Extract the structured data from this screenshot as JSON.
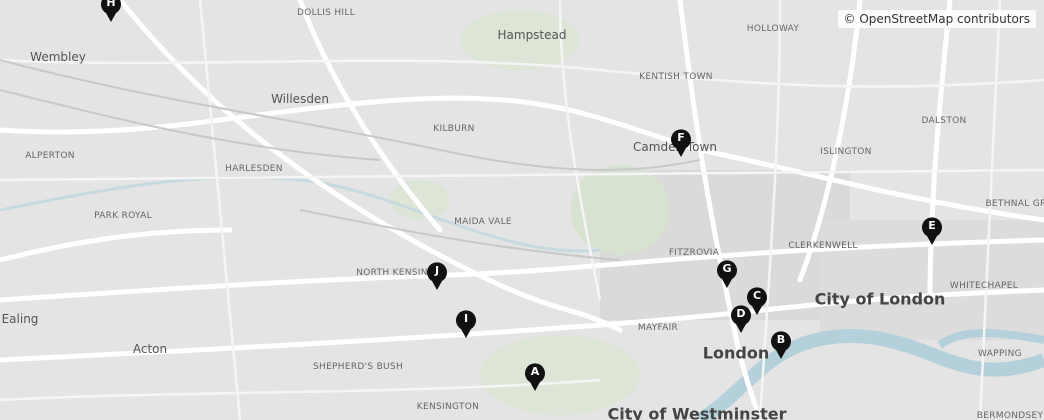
{
  "attribution": "© OpenStreetMap contributors",
  "places": {
    "dollis_hill": "DOLLIS HILL",
    "hampstead": "Hampstead",
    "holloway": "HOLLOWAY",
    "wembley": "Wembley",
    "kentish_town": "KENTISH TOWN",
    "willesden": "Willesden",
    "kilburn": "KILBURN",
    "dalston": "DALSTON",
    "alperton": "ALPERTON",
    "camden_town": "Camden Town",
    "islington": "ISLINGTON",
    "harlesden": "HARLESDEN",
    "bethnal_green": "BETHNAL GR",
    "park_royal": "PARK ROYAL",
    "maida_vale": "MAIDA VALE",
    "fitzrovia": "FITZROVIA",
    "clerkenwell": "CLERKENWELL",
    "north_kensington": "NORTH KENSIN",
    "city_of_london": "City of London",
    "whitechapel": "WHITECHAPEL",
    "ealing": "Ealing",
    "mayfair": "MAYFAIR",
    "acton": "Acton",
    "london": "London",
    "wapping": "WAPPING",
    "shepherds_bush": "SHEPHERD'S BUSH",
    "kensington": "KENSINGTON",
    "city_of_westminster": "City of Westminster",
    "bermondsey": "BERMONDSEY"
  },
  "markers": [
    {
      "label": "A"
    },
    {
      "label": "B"
    },
    {
      "label": "C"
    },
    {
      "label": "D"
    },
    {
      "label": "E"
    },
    {
      "label": "F"
    },
    {
      "label": "G"
    },
    {
      "label": "H"
    },
    {
      "label": "I"
    },
    {
      "label": "J"
    }
  ],
  "colors": {
    "marker_fill": "#111111",
    "water": "#b4d0da",
    "park": "#d8e2d0",
    "road": "#ffffff",
    "background": "#e6e6e6"
  }
}
